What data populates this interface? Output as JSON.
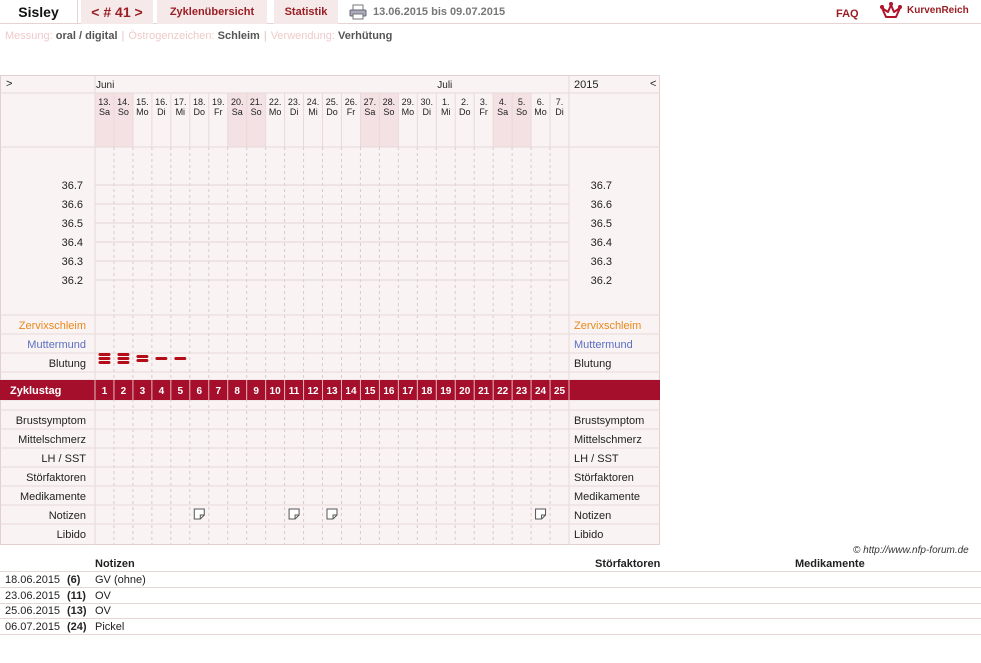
{
  "header": {
    "user": "Sisley",
    "cycle_label": "< # 41 >",
    "tabs": [
      "Zyklenübersicht",
      "Statistik"
    ],
    "range": "13.06.2015 bis 09.07.2015",
    "faq": "FAQ",
    "logo": "KurvenReich"
  },
  "subline": {
    "messung_label": "Messung:",
    "messung_value": "oral / digital",
    "oestrogen_label": "Östrogenzeichen:",
    "oestrogen_value": "Schleim",
    "verwendung_label": "Verwendung:",
    "verwendung_value": "Verhütung"
  },
  "chart": {
    "nav_prev": ">",
    "nav_next": "<",
    "year": "2015",
    "months": [
      {
        "label": "Juni",
        "day_index": 0
      },
      {
        "label": "Juli",
        "day_index": 18
      }
    ],
    "dates": [
      "13.",
      "14.",
      "15.",
      "16.",
      "17.",
      "18.",
      "19.",
      "20.",
      "21.",
      "22.",
      "23.",
      "24.",
      "25.",
      "26.",
      "27.",
      "28.",
      "29.",
      "30.",
      "1.",
      "2.",
      "3.",
      "4.",
      "5.",
      "6.",
      "7."
    ],
    "weekdays": [
      "Sa",
      "So",
      "Mo",
      "Di",
      "Mi",
      "Do",
      "Fr",
      "Sa",
      "So",
      "Mo",
      "Di",
      "Mi",
      "Do",
      "Fr",
      "Sa",
      "So",
      "Mo",
      "Di",
      "Mi",
      "Do",
      "Fr",
      "Sa",
      "So",
      "Mo",
      "Di"
    ],
    "weekend_days": [
      0,
      1,
      7,
      8,
      14,
      15,
      21,
      22
    ],
    "temp_levels": [
      "36.7",
      "36.6",
      "36.5",
      "36.4",
      "36.3",
      "36.2"
    ],
    "labels": {
      "zervix": "Zervixschleim",
      "muttermund": "Muttermund",
      "blutung": "Blutung",
      "zyklustag": "Zyklustag",
      "brust": "Brustsymptom",
      "mittel": "Mittelschmerz",
      "lh": "LH / SST",
      "stoer": "Störfaktoren",
      "medi": "Medikamente",
      "notizen": "Notizen",
      "libido": "Libido"
    },
    "cycle_days": [
      "1",
      "2",
      "3",
      "4",
      "5",
      "6",
      "7",
      "8",
      "9",
      "10",
      "11",
      "12",
      "13",
      "14",
      "15",
      "16",
      "17",
      "18",
      "19",
      "20",
      "21",
      "22",
      "23",
      "24",
      "25"
    ],
    "bleeding": [
      {
        "day": 1,
        "level": 3
      },
      {
        "day": 2,
        "level": 3
      },
      {
        "day": 3,
        "level": 2
      },
      {
        "day": 4,
        "level": 1
      },
      {
        "day": 5,
        "level": 1
      }
    ],
    "note_days": [
      6,
      11,
      13,
      24
    ],
    "colors": {
      "accent": "#a50f2c",
      "weekend": "#f3e1e3",
      "zervix": "#e8891c",
      "muttermund": "#5a6fc2"
    }
  },
  "notes_table": {
    "credit": "© http://www.nfp-forum.de",
    "headers": {
      "notizen": "Notizen",
      "stoer": "Störfaktoren",
      "medi": "Medikamente"
    },
    "rows": [
      {
        "date": "18.06.2015",
        "cycle": "(6)",
        "note": "GV (ohne)"
      },
      {
        "date": "23.06.2015",
        "cycle": "(11)",
        "note": "OV"
      },
      {
        "date": "25.06.2015",
        "cycle": "(13)",
        "note": "OV"
      },
      {
        "date": "06.07.2015",
        "cycle": "(24)",
        "note": "Pickel"
      }
    ]
  }
}
